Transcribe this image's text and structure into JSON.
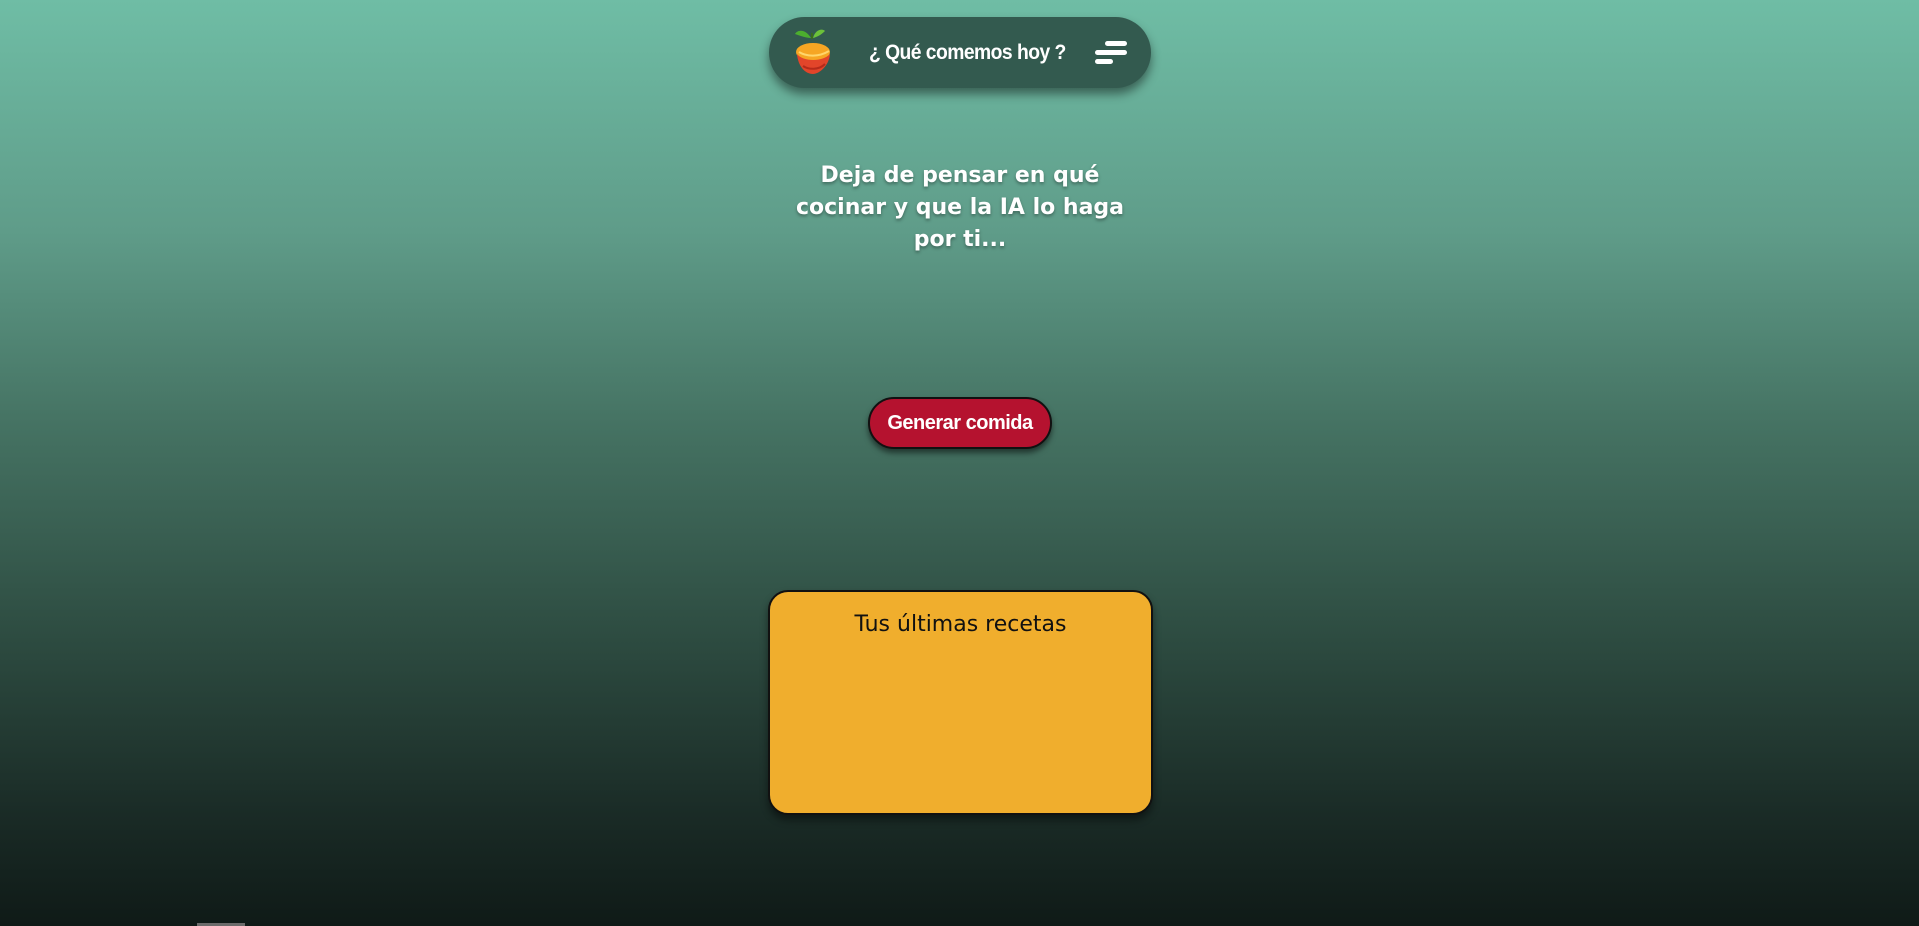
{
  "header": {
    "title": "¿ Qué comemos hoy ?",
    "logo_icon": "fruit-logo-icon",
    "menu_icon": "hamburger-menu-icon"
  },
  "main": {
    "tagline": "Deja de pensar en qué cocinar y que la IA lo haga por ti...",
    "generate_button_label": "Generar comida"
  },
  "recipes": {
    "title": "Tus últimas recetas",
    "items": []
  },
  "colors": {
    "navbar": "#335a4f",
    "accent_button": "#b5122f",
    "card": "#f0ae2d",
    "gradient_top": "#6fbda5",
    "gradient_bottom": "#0f1a17"
  }
}
